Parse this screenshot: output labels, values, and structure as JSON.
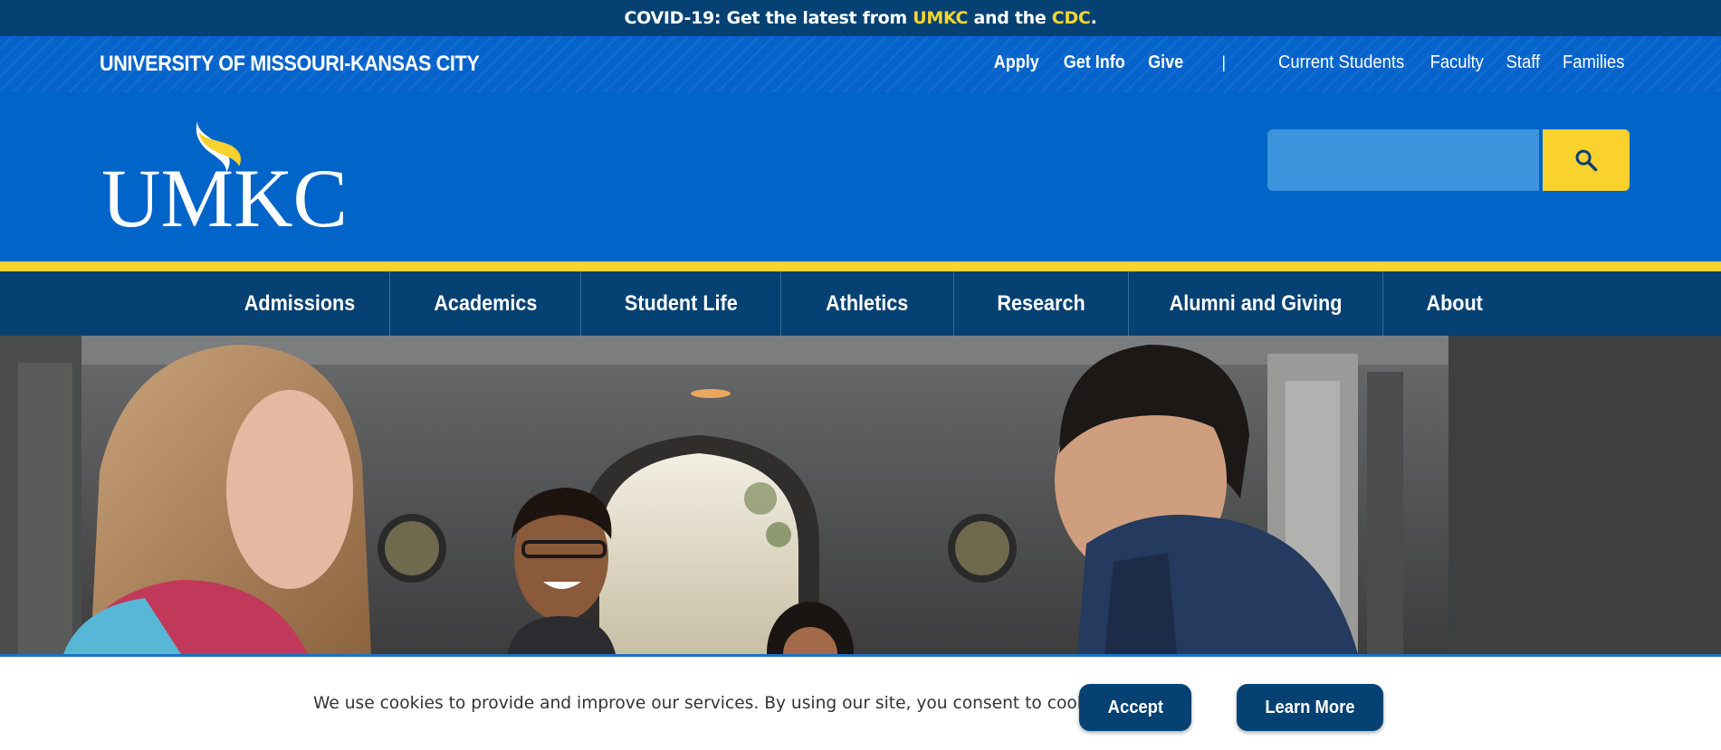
{
  "alert": {
    "prefix": "COVID-19: Get the latest from ",
    "link1": "UMKC",
    "middle": " and the ",
    "link2": "CDC",
    "suffix": "."
  },
  "header": {
    "university_name": "UNIVERSITY OF MISSOURI-KANSAS CITY",
    "logo_text": "UMKC",
    "utility_primary": [
      "Apply",
      "Get Info",
      "Give"
    ],
    "separator": "|",
    "utility_audience": [
      "Current Students",
      "Faculty",
      "Staff",
      "Families"
    ],
    "search": {
      "placeholder": "",
      "button_icon": "search-icon"
    }
  },
  "nav": {
    "items": [
      "Admissions",
      "Academics",
      "Student Life",
      "Athletics",
      "Research",
      "Alumni and Giving",
      "About"
    ]
  },
  "cookie": {
    "message": "We use cookies to provide and improve our services. By using our site, you consent to cookies.",
    "accept_label": "Accept",
    "learn_more_label": "Learn More"
  },
  "colors": {
    "brand_blue": "#0064c8",
    "navy": "#054172",
    "gold": "#f9d22e"
  }
}
